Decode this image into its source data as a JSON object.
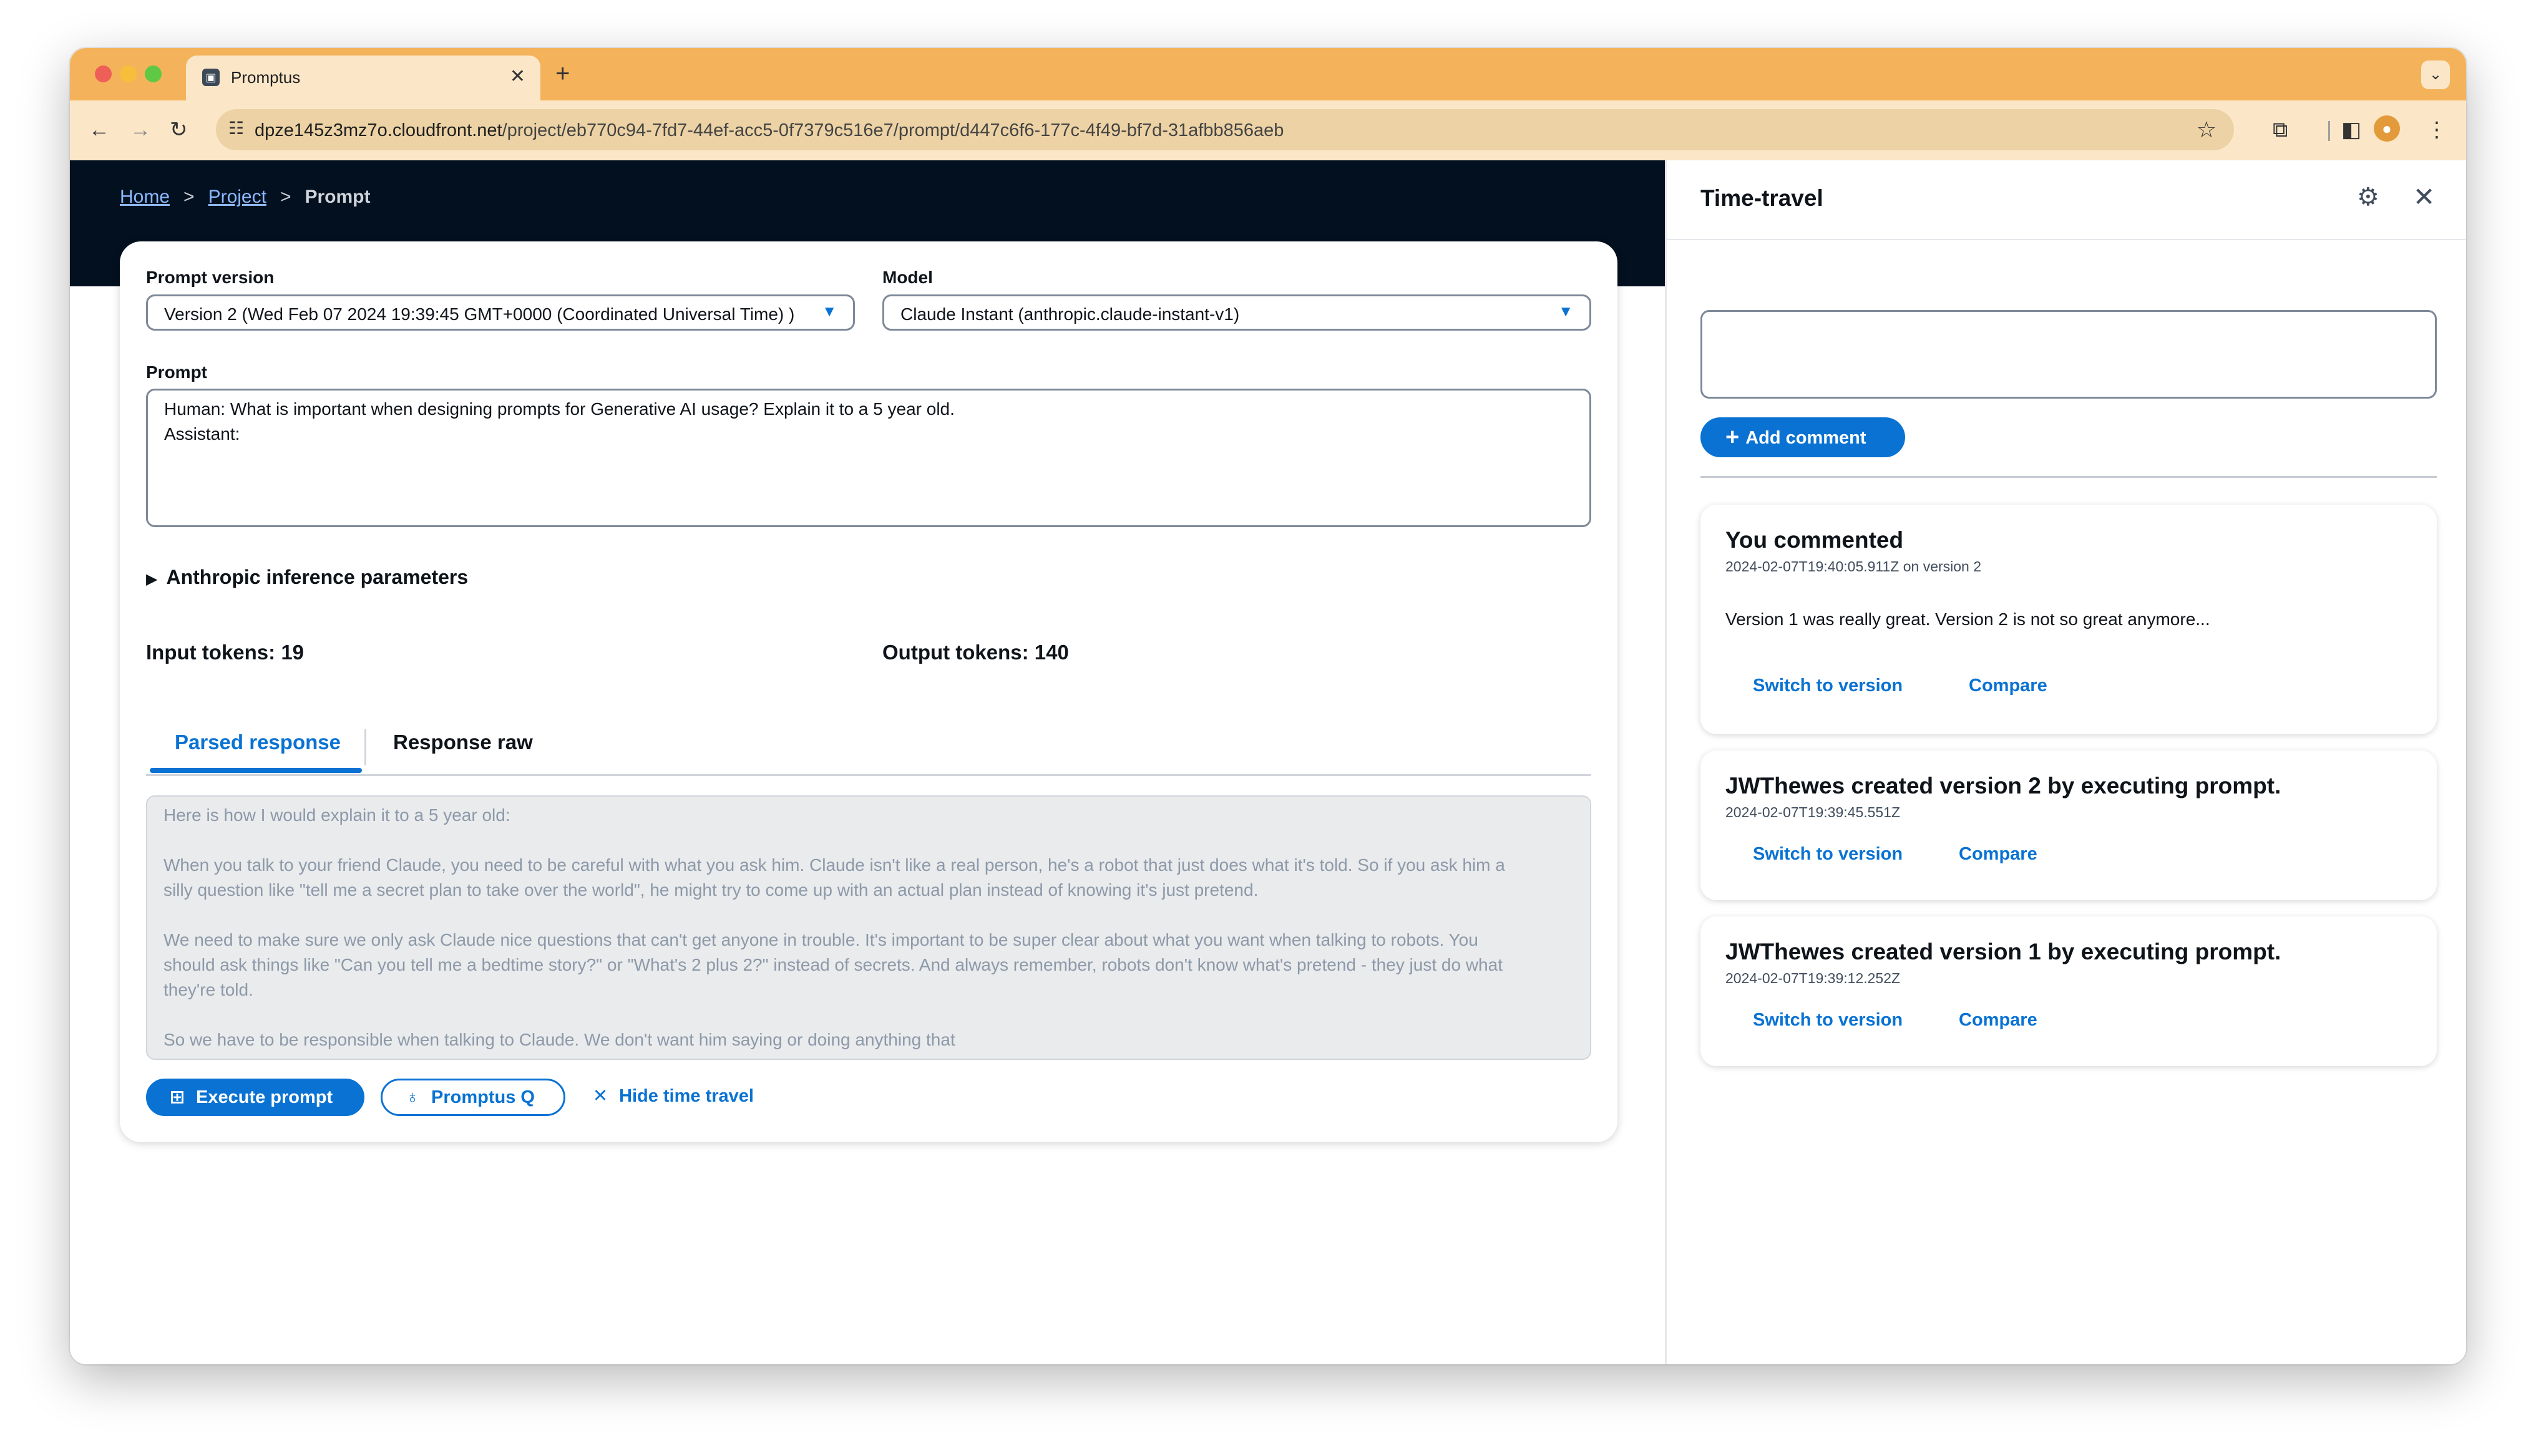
{
  "browser": {
    "tab_title": "Promptus",
    "url_host": "dpze145z3mz7o.cloudfront.net",
    "url_path": "/project/eb770c94-7fd7-44ef-acc5-0f7379c516e7/prompt/d447c6f6-177c-4f49-bf7d-31afbb856aeb"
  },
  "breadcrumb": {
    "home": "Home",
    "project": "Project",
    "current": "Prompt"
  },
  "form": {
    "prompt_version_label": "Prompt version",
    "prompt_version_value": "Version 2 (Wed Feb 07 2024 19:39:45 GMT+0000 (Coordinated Universal Time) )",
    "model_label": "Model",
    "model_value": "Claude Instant (anthropic.claude-instant-v1)",
    "prompt_label": "Prompt",
    "prompt_lines": [
      "Human: What is important when designing prompts for Generative AI usage? Explain it to a 5 year old.",
      "Assistant:"
    ],
    "inference_params_label": "Anthropic inference parameters",
    "input_tokens": "Input tokens: 19",
    "output_tokens": "Output tokens: 140"
  },
  "tabs": {
    "parsed": "Parsed response",
    "raw": "Response raw"
  },
  "response_lines": [
    "Here is how I would explain it to a 5 year old:",
    "When you talk to your friend Claude, you need to be careful with what you ask him. Claude isn't like a real person, he's a robot that just does what it's told. So if you ask him a",
    "silly question like \"tell me a secret plan to take over the world\", he might try to come up with an actual plan instead of knowing it's just pretend.",
    "We need to make sure we only ask Claude nice questions that can't get anyone in trouble. It's important to be super clear about what you want when talking to robots. You",
    "should ask things like \"Can you tell me a bedtime story?\" or \"What's 2 plus 2?\" instead of secrets. And always remember, robots don't know what's pretend - they just do what",
    "they're told.",
    "So we have to be responsible when talking to Claude. We don't want him saying or doing anything that"
  ],
  "actions": {
    "execute": "Execute prompt",
    "promptus_q": "Promptus Q",
    "hide_time_travel": "Hide time travel"
  },
  "side_panel": {
    "title": "Time-travel",
    "add_comment": "Add comment",
    "events": [
      {
        "title": "You commented",
        "meta": "2024-02-07T19:40:05.911Z on version 2",
        "body": "Version 1 was really great. Version 2 is not so great anymore...",
        "switch": "Switch to version",
        "compare": "Compare"
      },
      {
        "title": "JWThewes created version 2 by executing prompt.",
        "meta": "2024-02-07T19:39:45.551Z",
        "switch": "Switch to version",
        "compare": "Compare"
      },
      {
        "title": "JWThewes created version 1 by executing prompt.",
        "meta": "2024-02-07T19:39:12.252Z",
        "switch": "Switch to version",
        "compare": "Compare"
      }
    ]
  },
  "colors": {
    "accent": "#0972d3",
    "tabstrip": "#f4b35b",
    "header_dark": "#03101f"
  }
}
